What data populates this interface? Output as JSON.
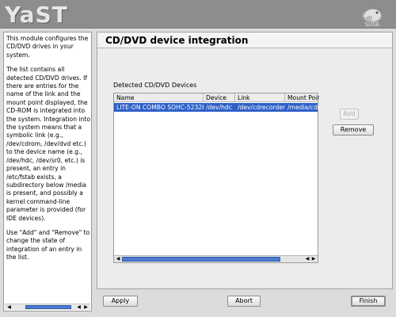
{
  "app": {
    "logo_text": "YaST",
    "brand_icon": "suse-chameleon-icon"
  },
  "help": {
    "paragraphs": [
      "This module configures the CD/DVD drives in your system.",
      "The list contains all detected CD/DVD drives. If there are entries for the name of the link and the mount point displayed, the CD-ROM is integrated into the system. Integration into the system means that a symbolic link (e.g., /dev/cdrom, /dev/dvd etc.) to the device name (e.g., /dev/hdc, /dev/sr0, etc.) is present, an entry in /etc/fstab exists, a subdirectory below /media is present, and possibly a kernel command-line parameter is provided (for IDE devices).",
      "Use \"Add\" and \"Remove\" to change the state of integration of an entry in the list."
    ]
  },
  "main": {
    "title": "CD/DVD device integration",
    "devices_label": "Detected CD/DVD Devices",
    "table": {
      "columns": [
        "Name",
        "Device",
        "Link",
        "Mount Poir"
      ],
      "rows": [
        [
          "LITE-ON COMBO SOHC-5232K",
          "/dev/hdc",
          "/dev/cdrecorder",
          "/media/cdr"
        ]
      ]
    },
    "add_label": "Add",
    "remove_label": "Remove"
  },
  "footer": {
    "apply_label": "Apply",
    "abort_label": "Abort",
    "finish_label": "Finish"
  },
  "colors": {
    "selection": "#2d5fc8",
    "header_bg": "#8d8d8d",
    "panel_bg": "#ececec"
  }
}
